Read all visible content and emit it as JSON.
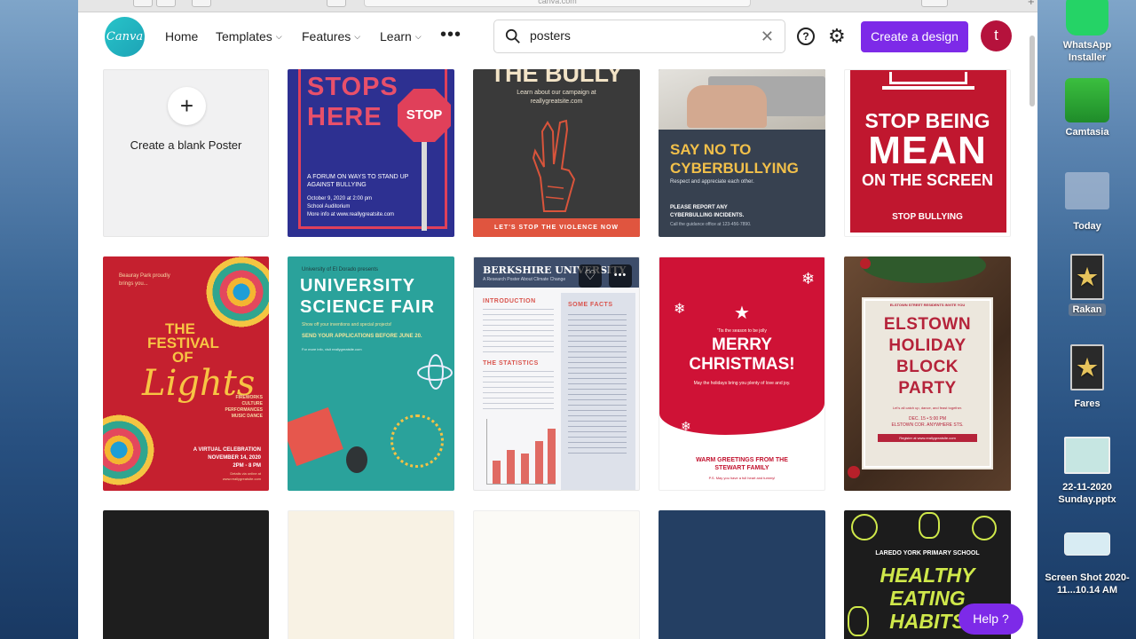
{
  "browser": {
    "url": "canva.com"
  },
  "nav": {
    "logo": "Canva",
    "home": "Home",
    "templates": "Templates",
    "features": "Features",
    "learn": "Learn",
    "search_value": "posters",
    "create_design": "Create a design",
    "avatar_initial": "t"
  },
  "blank_card": {
    "plus": "+",
    "label": "Create a blank Poster"
  },
  "posters": {
    "p1": {
      "l1": "STOPS",
      "l2": "HERE",
      "sign": "STOP",
      "body": "A FORUM ON WAYS TO STAND UP AGAINST BULLYING",
      "details": "October 9, 2020 at 2:00 pm\nSchool Auditorium\nMore info at www.reallygreatsite.com"
    },
    "p2": {
      "title": "THE BULLY",
      "sub": "Learn about our campaign at reallygreatsite.com",
      "footer": "LET'S STOP THE VIOLENCE NOW"
    },
    "p3": {
      "title": "SAY NO TO CYBERBULLYING",
      "sub": "Respect and appreciate each other.",
      "body": "PLEASE REPORT ANY CYBERBULLING INCIDENTS.",
      "small": "Call the guidance office at 123-456-7890."
    },
    "p4": {
      "l1": "STOP BEING",
      "l2": "MEAN",
      "l3": "ON THE SCREEN",
      "footer": "STOP BULLYING"
    },
    "p5": {
      "intro": "Beauray Park proudly brings you...",
      "l1": "THE",
      "l2": "FESTIVAL",
      "l3": "OF",
      "script": "Lights",
      "side": "FIREWORKS\nCULTURE\nPERFORMANCES\nMUSIC DANCE",
      "event": "A VIRTUAL CELEBRATION\nNOVEMBER 14, 2020\n2PM - 8 PM",
      "small": "Details via online at\nwww.reallygreatsite.com"
    },
    "p6": {
      "top": "University of El Dorado presents",
      "l1": "UNIVERSITY",
      "l2": "SCIENCE FAIR",
      "sub": "Show off your inventions and special projects!",
      "cta": "SEND YOUR APPLICATIONS BEFORE JUNE 20.",
      "small": "For more info, visit reallygreatsite.com"
    },
    "p7": {
      "title": "BERKSHIRE UNIVERSITY",
      "sub": "A Research Poster About Climate Change",
      "h1": "INTRODUCTION",
      "h2": "SOME FACTS",
      "h3": "THE STATISTICS"
    },
    "p8": {
      "intro": "'Tis the season to be jolly",
      "l1": "MERRY",
      "l2": "CHRISTMAS!",
      "sub": "May the holidays bring you plenty of love and joy.",
      "footer": "WARM GREETINGS FROM THE\nSTEWART FAMILY",
      "small": "P.S. May you have a full heart and tummy!"
    },
    "p9": {
      "top": "ELSTOWN STREET RESIDENTS INVITE YOU",
      "l1": "ELSTOWN",
      "l2": "HOLIDAY",
      "l3": "BLOCK",
      "l4": "PARTY",
      "sub": "Let's all catch up, dance, and feast together.",
      "date": "DEC. 15 • 5:00 PM\nELSTOWN COR. ANYWHERE STS.",
      "small": "Register at www.reallygreatsite.com"
    },
    "p10": {
      "top": "LAREDO YORK PRIMARY SCHOOL",
      "l1": "HEALTHY",
      "l2": "EATING",
      "l3": "HABITS"
    }
  },
  "help_button": "Help ?",
  "dock": {
    "whatsapp": "WhatsApp Installer",
    "camtasia": "Camtasia",
    "today": "Today",
    "rakan": "Rakan",
    "fares": "Fares",
    "pptx": "22-11-2020 Sunday.pptx",
    "screenshot": "Screen Shot 2020-11...10.14 AM"
  }
}
